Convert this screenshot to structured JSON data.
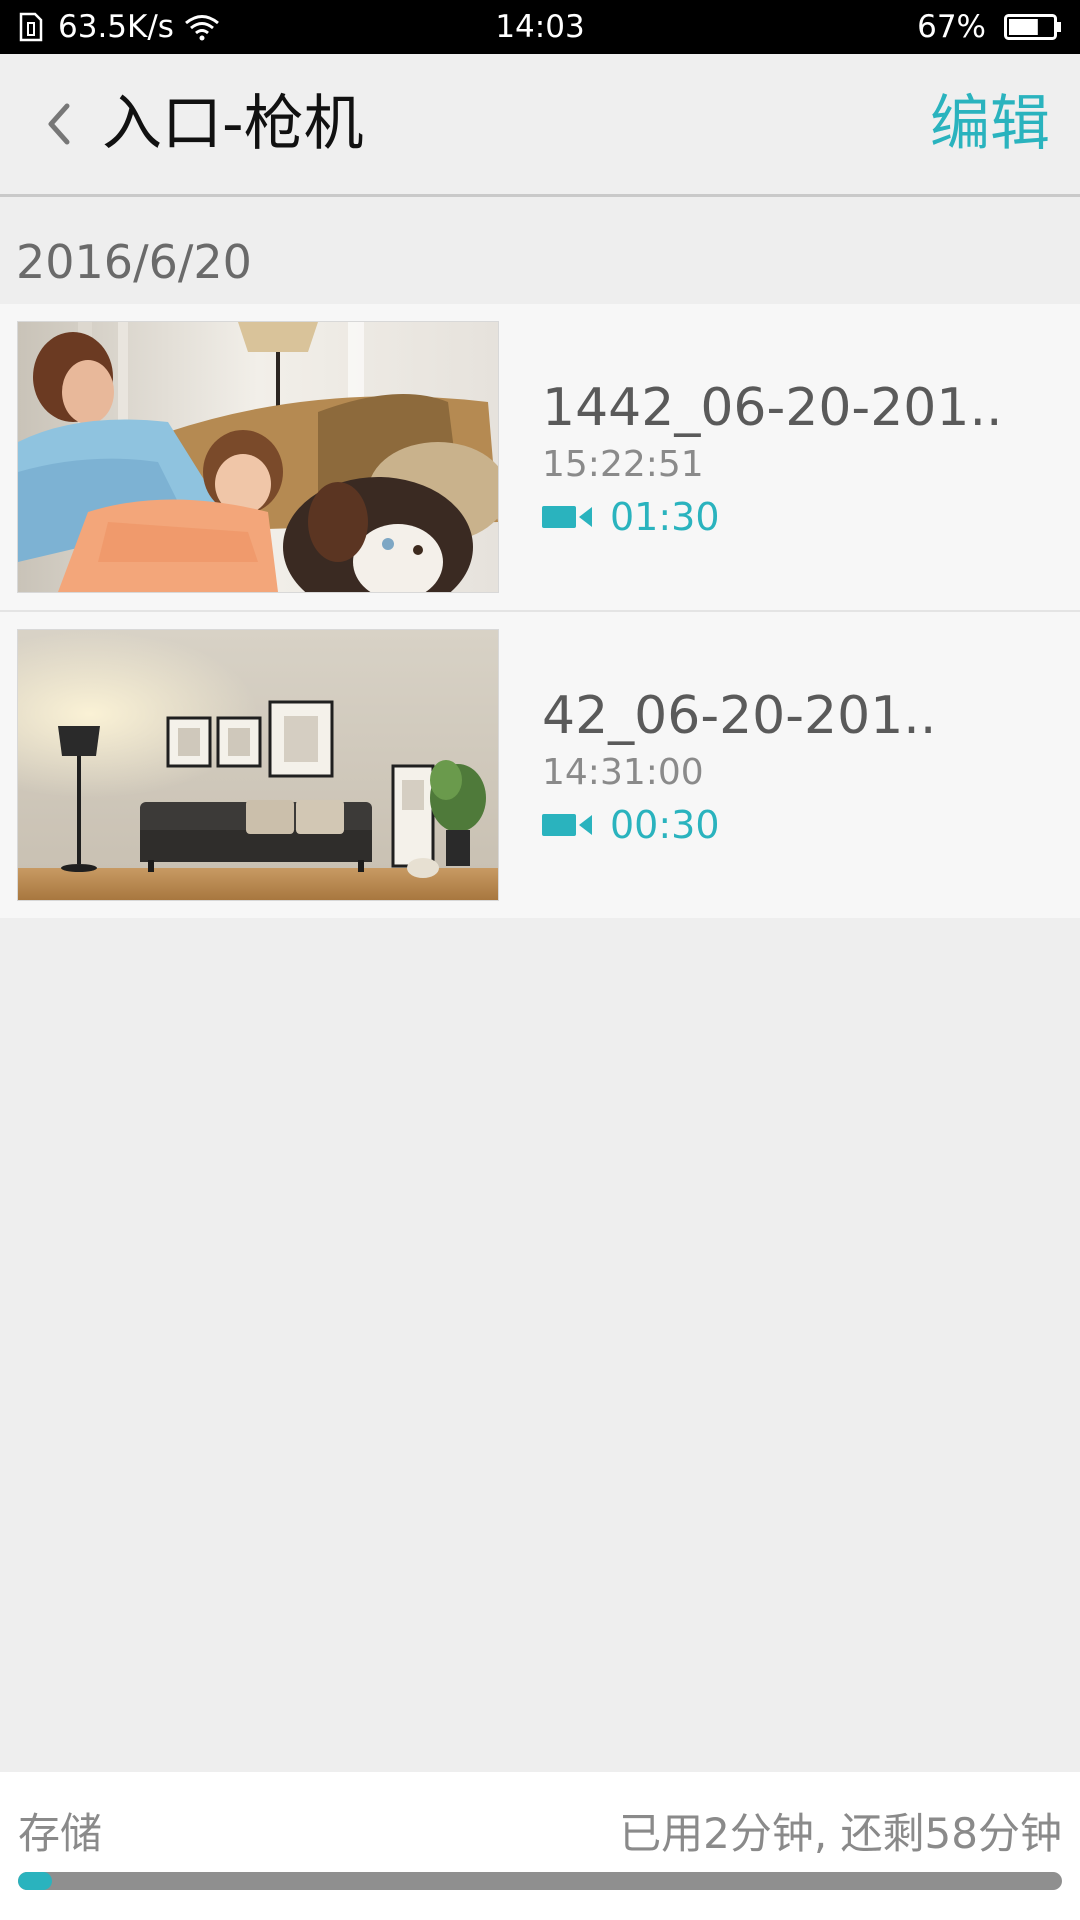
{
  "status_bar": {
    "network_speed": "63.5K/s",
    "time": "14:03",
    "battery": "67%",
    "battery_level": 0.67
  },
  "header": {
    "title": "入口-枪机",
    "edit_label": "编辑"
  },
  "date_group": "2016/6/20",
  "recordings": [
    {
      "name": "1442_06-20-201..",
      "time": "15:22:51",
      "duration": "01:30"
    },
    {
      "name": "42_06-20-201..",
      "time": "14:31:00",
      "duration": "00:30"
    }
  ],
  "storage": {
    "label": "存储",
    "status": "已用2分钟, 还剩58分钟",
    "used_fraction": 0.033
  },
  "colors": {
    "accent": "#2ab3be",
    "status_bar": "#000000",
    "background": "#eeeeee"
  },
  "icons": [
    "sim-icon",
    "wifi-icon",
    "battery-icon",
    "back-chevron-icon",
    "video-camera-icon"
  ]
}
